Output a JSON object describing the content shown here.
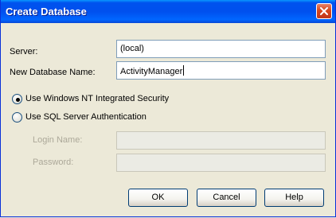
{
  "window": {
    "title": "Create Database"
  },
  "form": {
    "server_label": "Server:",
    "server_value": "(local)",
    "dbname_label": "New Database Name:",
    "dbname_value": "ActivityManager",
    "auth_windows_label": "Use Windows NT Integrated Security",
    "auth_sql_label": "Use SQL Server Authentication",
    "login_label": "Login Name:",
    "login_value": "",
    "password_label": "Password:",
    "password_value": "",
    "selected_auth": "windows"
  },
  "buttons": {
    "ok": "OK",
    "cancel": "Cancel",
    "help": "Help"
  },
  "colors": {
    "titlebar": "#0053ee",
    "close": "#d8471b",
    "face": "#ece9d8"
  }
}
